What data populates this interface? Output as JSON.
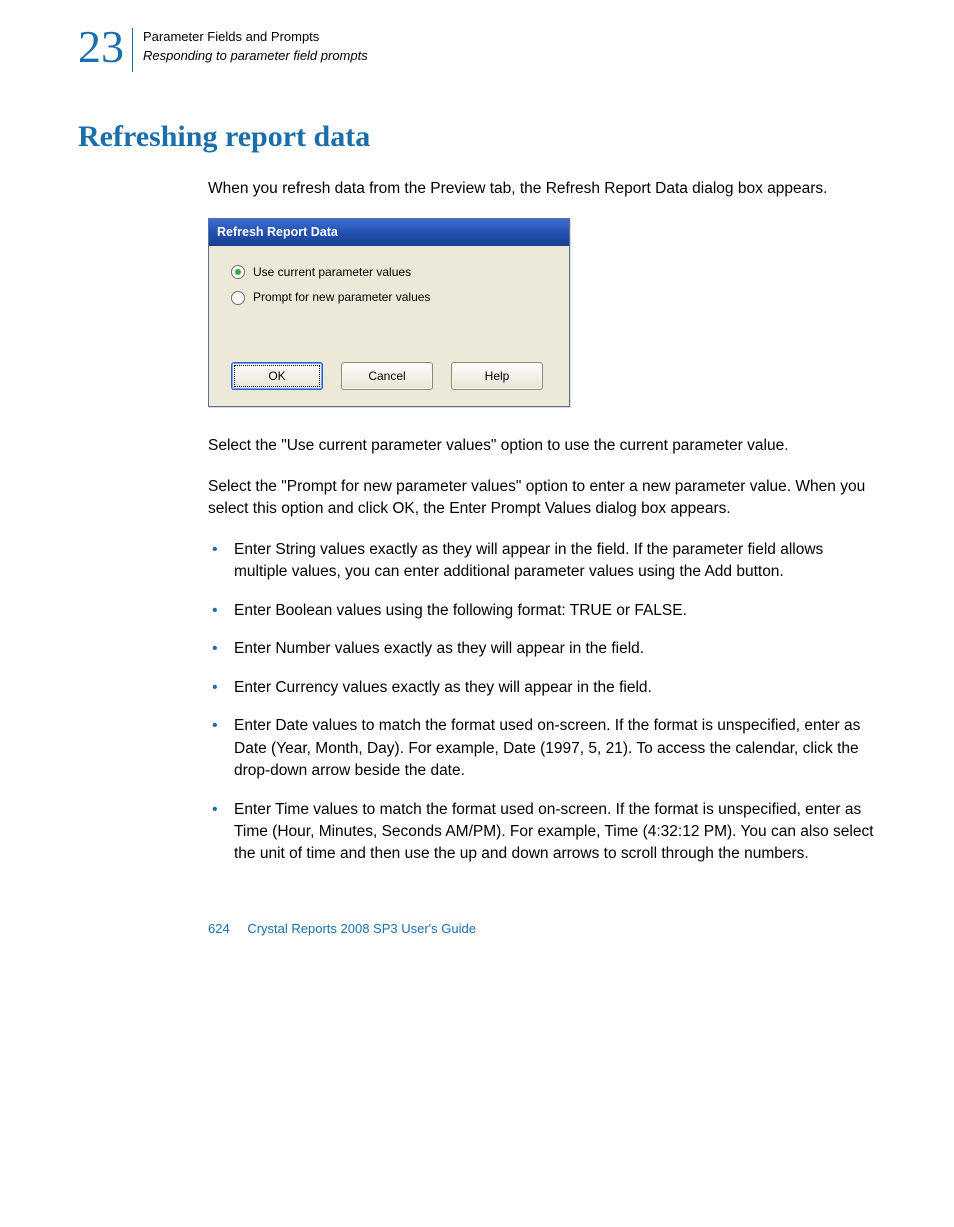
{
  "header": {
    "chapter_number": "23",
    "line1": "Parameter Fields and Prompts",
    "line2": "Responding to parameter field prompts"
  },
  "section_title": "Refreshing report data",
  "intro_para": "When you refresh data from the Preview tab, the Refresh Report Data dialog box appears.",
  "dialog": {
    "title": "Refresh Report Data",
    "option1": "Use current parameter values",
    "option2": "Prompt for new parameter values",
    "ok": "OK",
    "cancel": "Cancel",
    "help": "Help"
  },
  "para_after_dialog_1": "Select the \"Use current parameter values\" option to use the current parameter value.",
  "para_after_dialog_2": "Select the \"Prompt for new parameter values\" option to enter a new parameter value. When you select this option and click OK, the Enter Prompt Values dialog box appears.",
  "bullets": [
    "Enter String values exactly as they will appear in the field. If the parameter field allows multiple values, you can enter additional parameter values using the Add button.",
    "Enter Boolean values using the following format: TRUE or FALSE.",
    "Enter Number values exactly as they will appear in the field.",
    "Enter Currency values exactly as they will appear in the field.",
    "Enter Date values to match the format used on-screen. If the format is unspecified, enter as Date (Year, Month, Day). For example, Date (1997, 5, 21). To access the calendar, click the drop-down arrow beside the date.",
    "Enter Time values to match the format used on-screen. If the format is unspecified, enter as Time (Hour, Minutes, Seconds AM/PM). For example, Time (4:32:12 PM). You can also select the unit of time and then use the up and down arrows to scroll through the numbers."
  ],
  "footer": {
    "page_number": "624",
    "doc_title": "Crystal Reports 2008 SP3 User's Guide"
  }
}
